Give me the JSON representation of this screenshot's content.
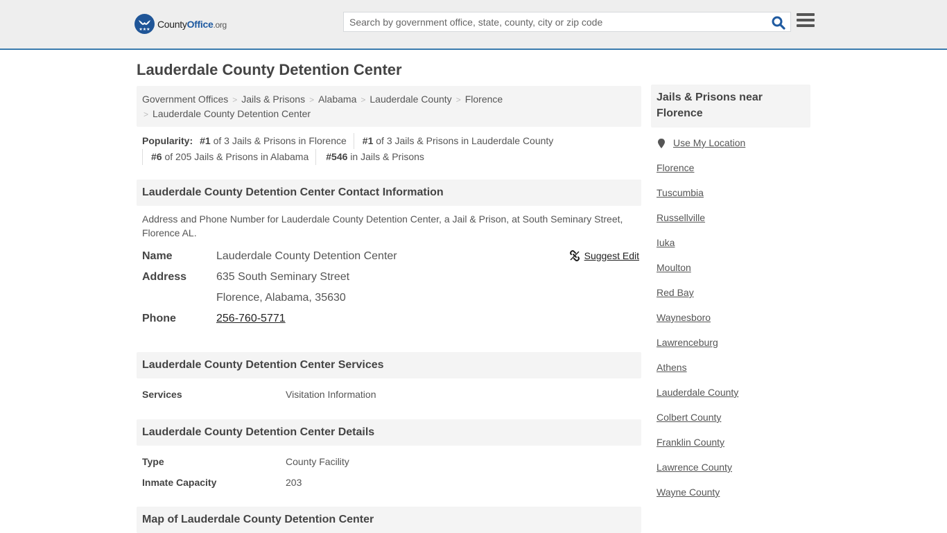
{
  "header": {
    "logo_main": "County",
    "logo_brand": "Office",
    "logo_tld": ".org",
    "search_placeholder": "Search by government office, state, county, city or zip code",
    "search_value": ""
  },
  "page": {
    "title": "Lauderdale County Detention Center"
  },
  "breadcrumb": [
    "Government Offices",
    "Jails & Prisons",
    "Alabama",
    "Lauderdale County",
    "Florence",
    "Lauderdale County Detention Center"
  ],
  "popularity": {
    "label": "Popularity:",
    "items": [
      {
        "rank": "#1",
        "text": " of 3 Jails & Prisons in Florence"
      },
      {
        "rank": "#1",
        "text": " of 3 Jails & Prisons in Lauderdale County"
      },
      {
        "rank": "#6",
        "text": " of 205 Jails & Prisons in Alabama"
      },
      {
        "rank": "#546",
        "text": " in Jails & Prisons"
      }
    ]
  },
  "contact": {
    "heading": "Lauderdale County Detention Center Contact Information",
    "description": "Address and Phone Number for Lauderdale County Detention Center, a Jail & Prison, at South Seminary Street, Florence AL.",
    "suggest_edit": "Suggest Edit",
    "name_label": "Name",
    "name_value": "Lauderdale County Detention Center",
    "address_label": "Address",
    "address_line1": "635 South Seminary Street",
    "address_line2": "Florence, Alabama, 35630",
    "phone_label": "Phone",
    "phone_value": "256-760-5771"
  },
  "services": {
    "heading": "Lauderdale County Detention Center Services",
    "label": "Services",
    "value": "Visitation Information"
  },
  "details": {
    "heading": "Lauderdale County Detention Center Details",
    "rows": [
      {
        "label": "Type",
        "value": "County Facility"
      },
      {
        "label": "Inmate Capacity",
        "value": "203"
      }
    ]
  },
  "map": {
    "heading": "Map of Lauderdale County Detention Center"
  },
  "sidebar": {
    "heading": "Jails & Prisons near Florence",
    "use_location": "Use My Location",
    "links": [
      "Florence",
      "Tuscumbia",
      "Russellville",
      "Iuka",
      "Moulton",
      "Red Bay",
      "Waynesboro",
      "Lawrenceburg",
      "Athens",
      "Lauderdale County",
      "Colbert County",
      "Franklin County",
      "Lawrence County",
      "Wayne County"
    ]
  },
  "colors": {
    "header_bg": "#eeeeee",
    "header_border": "#3a7bad",
    "logo_blue": "#1f5597",
    "search_icon": "#1f5aa0",
    "section_bg": "#f4f4f4"
  }
}
